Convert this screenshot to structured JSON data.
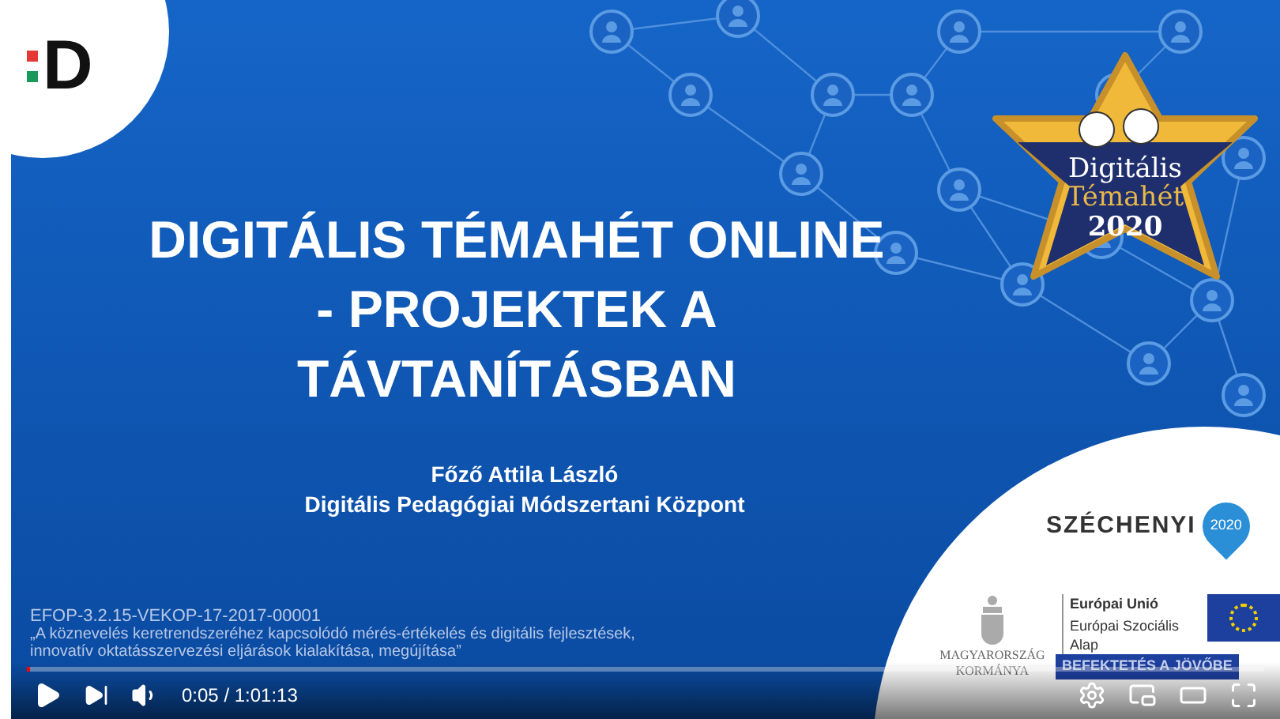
{
  "slide": {
    "logo_letter": "D",
    "title": "DIGITÁLIS TÉMAHÉT ONLINE\n- PROJEKTEK A\nTÁVTANÍTÁSBAN",
    "author": "Főző Attila László",
    "organization": "Digitális Pedagógiai Módszertani Központ",
    "badge": {
      "line_1": "Digitális",
      "line_2": "Témahét",
      "line_3": "2020"
    },
    "project_code": "EFOP-3.2.15-VEKOP-17-2017-00001",
    "project_title": "„A köznevelés keretrendszeréhez kapcsolódó mérés-értékelés és digitális fejlesztések,\ninnovatív oktatásszervezési eljárások kialakítása, megújítása”",
    "szechenyi": {
      "name": "SZÉCHENYI",
      "year": "2020"
    },
    "government": "MAGYARORSZÁG\nKORMÁNYA",
    "eu_title": "Európai Unió",
    "eu_subtitle": "Európai Szociális\nAlap",
    "slogan": "BEFEKTETÉS A JÖVŐBE"
  },
  "player": {
    "playing": false,
    "level": 0.002,
    "time": "0:05 / 1:01:13"
  }
}
